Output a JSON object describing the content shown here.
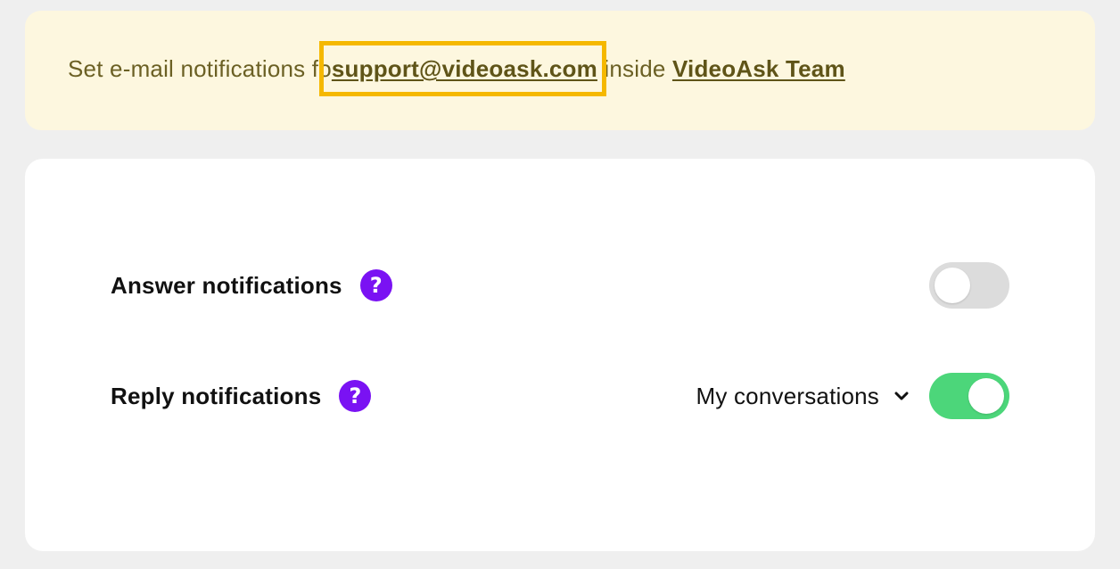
{
  "banner": {
    "prefix": "Set e-mail notifications fo",
    "email": "support@videoask.com",
    "middle": " inside ",
    "team": "VideoAsk Team"
  },
  "settings": {
    "answer": {
      "label": "Answer notifications",
      "help_icon": "?",
      "toggle_on": false
    },
    "reply": {
      "label": "Reply notifications",
      "help_icon": "?",
      "dropdown_value": "My conversations",
      "toggle_on": true
    }
  },
  "colors": {
    "banner_bg": "#fdf7df",
    "highlight": "#f5b800",
    "help_icon_bg": "#7a12f3",
    "toggle_on": "#4cd67a",
    "toggle_off": "#dcdcdc"
  }
}
